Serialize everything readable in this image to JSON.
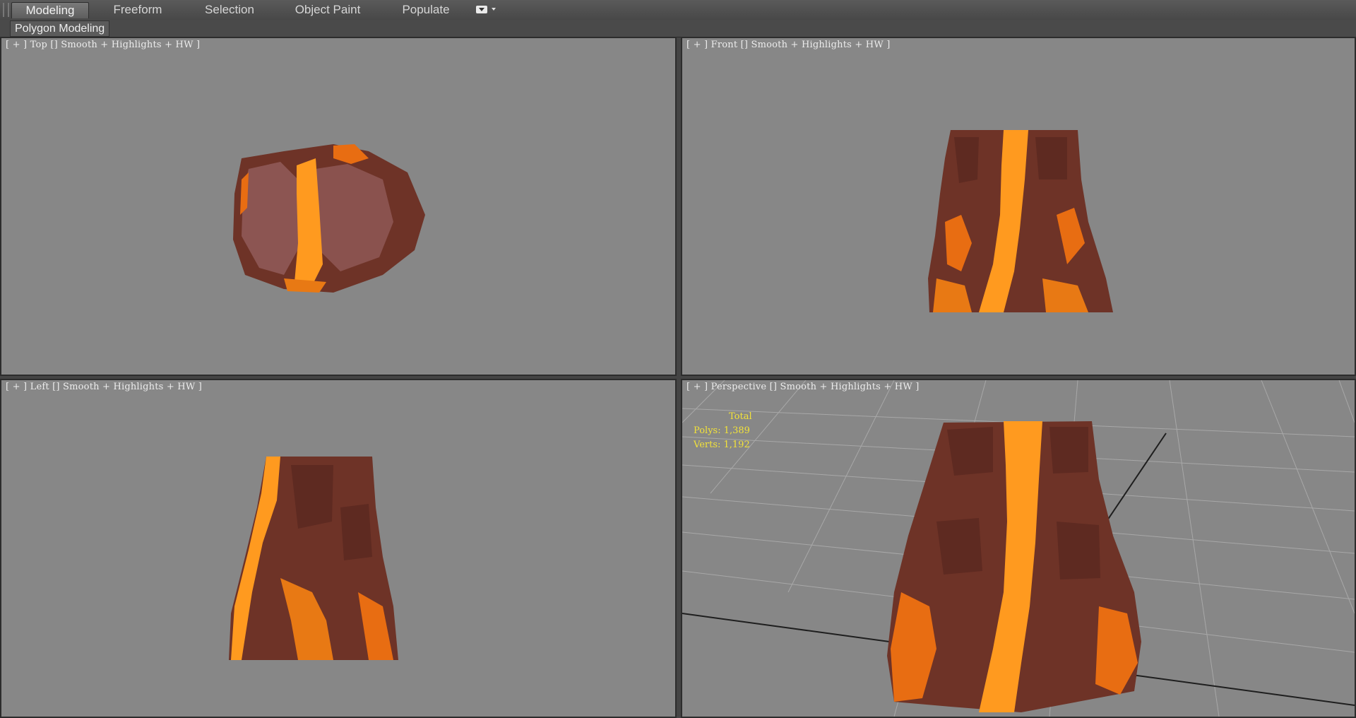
{
  "ribbon": {
    "tabs": [
      {
        "label": "Modeling",
        "active": true
      },
      {
        "label": "Freeform",
        "active": false
      },
      {
        "label": "Selection",
        "active": false
      },
      {
        "label": "Object Paint",
        "active": false
      },
      {
        "label": "Populate",
        "active": false
      }
    ],
    "menu_icon": "ribbon-display-options-icon",
    "panel_label": "Polygon Modeling"
  },
  "viewports": {
    "top": {
      "label": "[ + ] Top [] Smooth + Highlights + HW ]"
    },
    "front": {
      "label": "[ + ] Front [] Smooth + Highlights + HW ]"
    },
    "left": {
      "label": "[ + ] Left [] Smooth + Highlights + HW ]"
    },
    "perspective": {
      "label": "[ + ] Perspective [] Smooth + Highlights + HW ]"
    }
  },
  "stats": {
    "title": "Total",
    "polys": "Polys: 1,389",
    "verts": "Verts: 1,192"
  },
  "colors": {
    "viewport_bg": "#878787",
    "rock": "#7a3a2c",
    "lava": "#ff9a1f",
    "stats_text": "#f2e23a"
  }
}
